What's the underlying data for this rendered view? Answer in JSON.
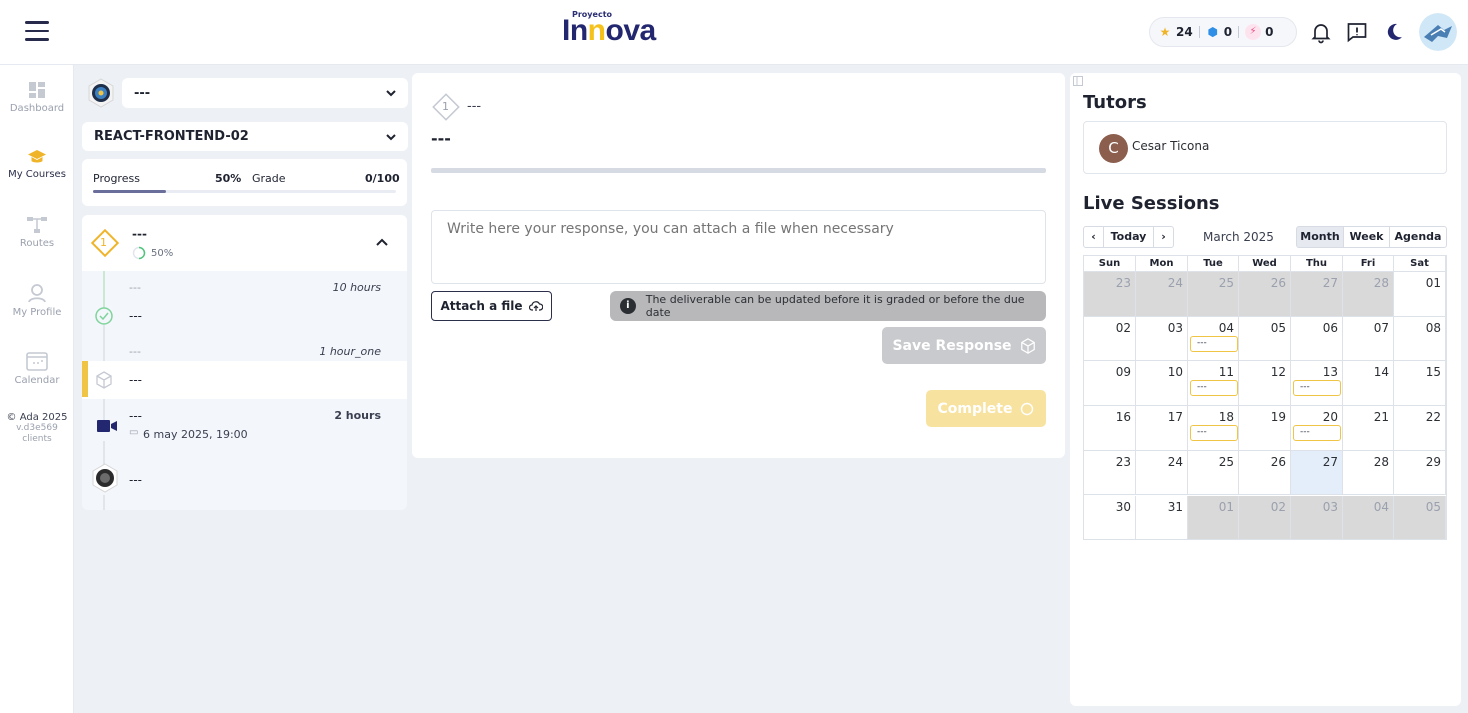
{
  "header": {
    "logo_small": "Proyecto",
    "logo_main_a": "In",
    "logo_main_b": "n",
    "logo_main_c": "ova",
    "stars": "24",
    "gems": "0",
    "energy": "0"
  },
  "sidebar": {
    "items": [
      {
        "label": "Dashboard"
      },
      {
        "label": "My Courses"
      },
      {
        "label": "Routes"
      },
      {
        "label": "My Profile"
      },
      {
        "label": "Calendar"
      }
    ],
    "copyright": "© Ada 2025",
    "version": "v.d3e569",
    "clients": "clients"
  },
  "course": {
    "selected_group": "---",
    "selected_course": "REACT-FRONTEND-02",
    "progress_label": "Progress",
    "progress_value": "50%",
    "progress_fraction": 0.5,
    "grade_label": "Grade",
    "grade_value": "0/100"
  },
  "module": {
    "number": "1",
    "title": "---",
    "percent": "50%",
    "items": [
      {
        "meta": "---",
        "duration": "10 hours",
        "title": "---"
      },
      {
        "meta": "---",
        "duration": "1 hour_one",
        "title": "---"
      },
      {
        "meta": "---",
        "duration": "2 hours",
        "date": "6 may 2025, 19:00"
      },
      {
        "title": "---"
      }
    ]
  },
  "main": {
    "step_number": "1",
    "step_label": "---",
    "title": "---",
    "placeholder": "Write here your response, you can attach a file when necessary",
    "attach_label": "Attach a file",
    "info_text": "The deliverable can be updated before it is graded or before the due date",
    "save_label": "Save Response",
    "complete_label": "Complete"
  },
  "right": {
    "tutors_title": "Tutors",
    "tutor_initial": "C",
    "tutor_name": "Cesar Ticona",
    "sessions_title": "Live Sessions",
    "today_label": "Today",
    "month_label": "March 2025",
    "views": [
      "Month",
      "Week",
      "Agenda"
    ],
    "weekdays": [
      "Sun",
      "Mon",
      "Tue",
      "Wed",
      "Thu",
      "Fri",
      "Sat"
    ],
    "weeks": [
      [
        "23",
        "24",
        "25",
        "26",
        "27",
        "28",
        "01"
      ],
      [
        "02",
        "03",
        "04",
        "05",
        "06",
        "07",
        "08"
      ],
      [
        "09",
        "10",
        "11",
        "12",
        "13",
        "14",
        "15"
      ],
      [
        "16",
        "17",
        "18",
        "19",
        "20",
        "21",
        "22"
      ],
      [
        "23",
        "24",
        "25",
        "26",
        "27",
        "28",
        "29"
      ],
      [
        "30",
        "31",
        "01",
        "02",
        "03",
        "04",
        "05"
      ]
    ],
    "event_label": "---"
  }
}
